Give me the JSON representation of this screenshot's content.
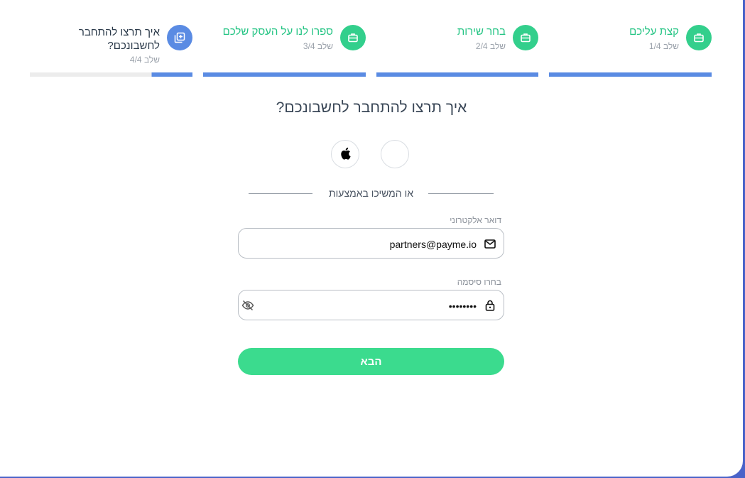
{
  "stepper": {
    "steps": [
      {
        "title": "קצת עליכם",
        "sub": "שלב 1/4",
        "icon": "briefcase-icon"
      },
      {
        "title": "בחר שירות",
        "sub": "שלב 2/4",
        "icon": "briefcase-icon"
      },
      {
        "title": "ספרו לנו על העסק שלכם",
        "sub": "שלב 3/4",
        "icon": "briefcase-icon"
      },
      {
        "title": "איך תרצו להתחבר לחשבונכם?",
        "sub": "שלב 4/4",
        "icon": "add-copy-icon"
      }
    ]
  },
  "main": {
    "heading": "איך תרצו להתחבר לחשבונכם?",
    "divider_text": "או המשיכו באמצעות",
    "email_label": "דואר אלקטרוני",
    "email_value": "partners@payme.io",
    "password_label": "בחרו סיסמה",
    "password_value": "••••••••",
    "next_label": "הבא"
  },
  "colors": {
    "accent_green": "#33cf8c",
    "step_blue": "#5a8be3",
    "button_green": "#3bdb8e",
    "frame_blue": "#4a63c9"
  }
}
